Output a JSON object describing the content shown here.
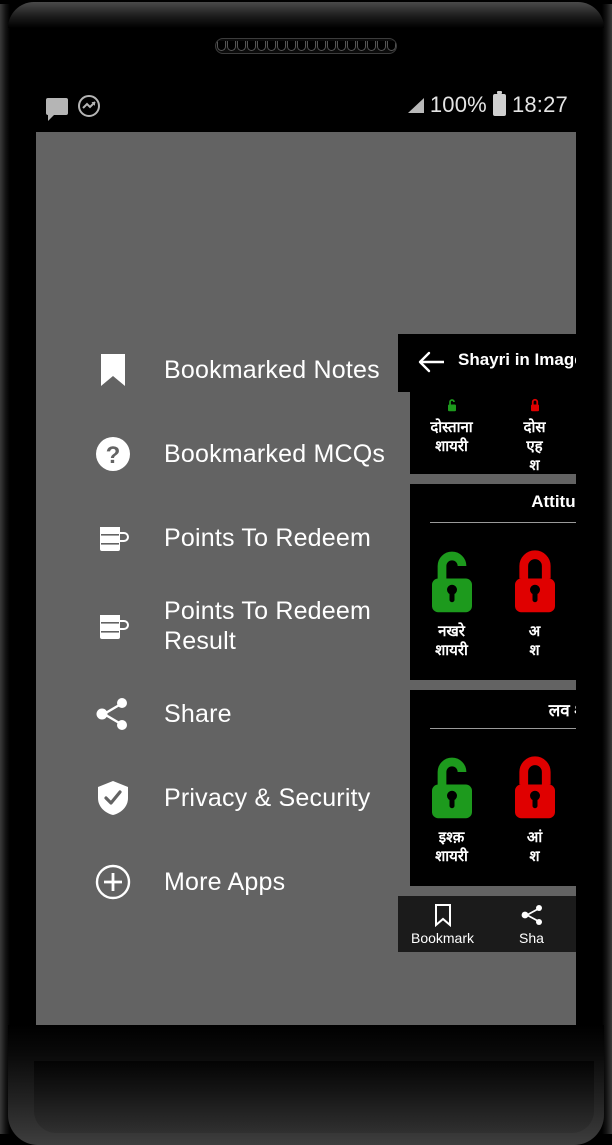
{
  "status_bar": {
    "left_icons": [
      "chat-bubble-icon",
      "messenger-icon"
    ],
    "signal_icon": "signal-triangle-icon",
    "battery_text": "100%",
    "battery_icon": "battery-full-icon",
    "clock": "18:27"
  },
  "drawer": {
    "items": [
      {
        "label": "Bookmarked Notes",
        "icon": "bookmark-filled-icon",
        "name": "bookmarked-notes"
      },
      {
        "label": "Bookmarked MCQs",
        "icon": "question-circle-icon",
        "name": "bookmarked-mcqs"
      },
      {
        "label": "Points To Redeem",
        "icon": "coffee-mug-icon",
        "name": "points-to-redeem"
      },
      {
        "label": "Points To Redeem Result",
        "icon": "coffee-mug-icon",
        "name": "points-to-redeem-result"
      },
      {
        "label": "Share",
        "icon": "share-nodes-icon",
        "name": "share"
      },
      {
        "label": "Privacy & Security",
        "icon": "shield-check-icon",
        "name": "privacy-and-security"
      },
      {
        "label": "More Apps",
        "icon": "plus-circle-icon",
        "name": "more-apps"
      }
    ]
  },
  "app_preview": {
    "back_icon": "arrow-left-icon",
    "title": "Shayri in Image",
    "cards": [
      {
        "section_title": "",
        "tiles": [
          {
            "caption": "दोस्ताना\nशायरी",
            "lock": "open",
            "color": "#1d9a1d"
          },
          {
            "caption": "दोस\nएह\nश",
            "lock": "closed",
            "color": "#e00000"
          }
        ]
      },
      {
        "section_title": "Attitud",
        "tiles": [
          {
            "caption": "नखरे\nशायरी",
            "lock": "open",
            "color": "#1d9a1d"
          },
          {
            "caption": "अ\nश",
            "lock": "closed",
            "color": "#e00000"
          }
        ]
      },
      {
        "section_title": "लव श",
        "tiles": [
          {
            "caption": "इश्क़\nशायरी",
            "lock": "open",
            "color": "#1d9a1d"
          },
          {
            "caption": "आं\nश",
            "lock": "closed",
            "color": "#e00000"
          }
        ]
      }
    ],
    "bottom_nav": [
      {
        "label": "Bookmark",
        "icon": "bookmark-outline-icon",
        "name": "bookmark"
      },
      {
        "label": "Sha",
        "icon": "share-nodes-icon",
        "name": "share"
      }
    ]
  },
  "colors": {
    "scrim": "#636363",
    "panel_bg": "#000000",
    "lock_open": "#1d9a1d",
    "lock_closed": "#e00000",
    "text": "#ffffff"
  }
}
